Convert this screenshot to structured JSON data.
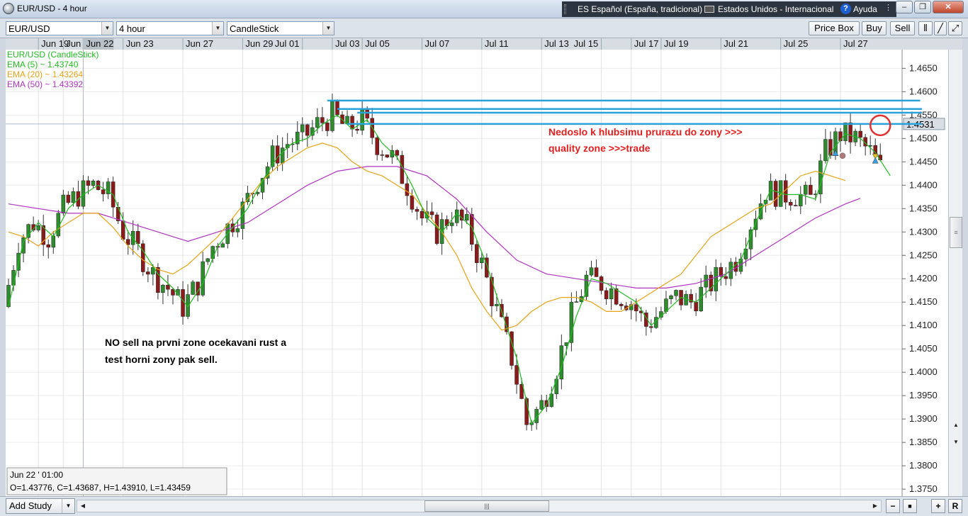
{
  "window": {
    "title": "EUR/USD - 4 hour",
    "lang_bar": {
      "language": "ES Español (España, tradicional)",
      "keyboard": "Estados Unidos - Internacional",
      "help": "Ayuda"
    },
    "buttons": {
      "minimize": "–",
      "restore": "❐",
      "close": "✕"
    }
  },
  "toolbar": {
    "symbol": "EUR/USD",
    "interval": "4 hour",
    "chart_style": "CandleStick",
    "price_box": "Price Box",
    "buy": "Buy",
    "sell": "Sell"
  },
  "legend": [
    {
      "text": "EUR/USD (CandleStick)",
      "color": "#22bb22"
    },
    {
      "text": "EMA (5) ~ 1.43740",
      "color": "#22bb22"
    },
    {
      "text": "EMA (20) ~ 1.43264",
      "color": "#e8a317"
    },
    {
      "text": "EMA (50) ~ 1.43392",
      "color": "#b033c0"
    }
  ],
  "annotations": {
    "top_right": [
      "Nedoslo k hlubsimu prurazu do zony >>>",
      "quality zone >>>trade"
    ],
    "bottom_left": [
      "NO sell na prvni zone ocekavani rust a",
      "test horni zony pak sell."
    ]
  },
  "info_box": {
    "date": "Jun 22 ' 01:00",
    "ohlc": "O=1.43776, C=1.43687, H=1.43910, L=1.43459"
  },
  "bottom": {
    "add_study": "Add Study",
    "scroll_grip": "|||",
    "r_button": "R"
  },
  "colors": {
    "bull": "#2e8b2e",
    "bear": "#8b1a1a",
    "ema5": "#22bb22",
    "ema20": "#e8a317",
    "ema50": "#b033c0",
    "zone": "#2aa1d8",
    "annot": "#e02020",
    "circle": "#e03030"
  },
  "chart_data": {
    "type": "candlestick",
    "symbol": "EUR/USD",
    "interval": "4 hour",
    "ylim": [
      1.3735,
      1.469
    ],
    "y_ticks": [
      1.375,
      1.38,
      1.385,
      1.39,
      1.395,
      1.4,
      1.405,
      1.41,
      1.415,
      1.42,
      1.425,
      1.43,
      1.435,
      1.44,
      1.445,
      1.45,
      1.455,
      1.46,
      1.465
    ],
    "y_tick_labels": [
      "1.3750",
      "1.3800",
      "1.3850",
      "1.3900",
      "1.3950",
      "1.4000",
      "1.4050",
      "1.4100",
      "1.4150",
      "1.4200",
      "1.4250",
      "1.4300",
      "1.4350",
      "1.4400",
      "1.4450",
      "1.4500",
      "1.4550",
      "1.4600",
      "1.4650"
    ],
    "current_price": "1.4531",
    "x_labels": [
      {
        "label": "Jun 19",
        "bar": 6
      },
      {
        "label": "Jun 21",
        "bar": 11
      },
      {
        "label": "Jun 22",
        "bar": 15
      },
      {
        "label": "Jun 23",
        "bar": 23
      },
      {
        "label": "Jun 27",
        "bar": 35
      },
      {
        "label": "Jun 29",
        "bar": 47
      },
      {
        "label": "Jul 01",
        "bar": 59
      },
      {
        "label": "Jul 03",
        "bar": 65
      },
      {
        "label": "Jul 05",
        "bar": 71
      },
      {
        "label": "Jul 07",
        "bar": 83
      },
      {
        "label": "Jul 11",
        "bar": 95
      },
      {
        "label": "Jul 13",
        "bar": 107
      },
      {
        "label": "Jul 15",
        "bar": 119
      },
      {
        "label": "Jul 17",
        "bar": 125
      },
      {
        "label": "Jul 19",
        "bar": 131
      },
      {
        "label": "Jul 21",
        "bar": 143
      },
      {
        "label": "Jul 25",
        "bar": 155
      },
      {
        "label": "Jul 27",
        "bar": 167
      }
    ],
    "zones": [
      {
        "y": 1.4581,
        "from_bar": 64,
        "to_bar": 183
      },
      {
        "y": 1.4563,
        "from_bar": 66,
        "to_bar": 186
      },
      {
        "y": 1.4555,
        "from_bar": 70,
        "to_bar": 186
      },
      {
        "y": 1.4531,
        "from_bar": 68,
        "to_bar": 186
      }
    ],
    "circle": {
      "bar": 175,
      "y": 1.4528
    },
    "ema5": [
      [
        0,
        1.414
      ],
      [
        3,
        1.428
      ],
      [
        6,
        1.432
      ],
      [
        9,
        1.429
      ],
      [
        12,
        1.435
      ],
      [
        15,
        1.438
      ],
      [
        18,
        1.44
      ],
      [
        21,
        1.438
      ],
      [
        24,
        1.43
      ],
      [
        27,
        1.426
      ],
      [
        30,
        1.421
      ],
      [
        33,
        1.418
      ],
      [
        36,
        1.414
      ],
      [
        39,
        1.419
      ],
      [
        42,
        1.427
      ],
      [
        45,
        1.431
      ],
      [
        48,
        1.435
      ],
      [
        51,
        1.441
      ],
      [
        54,
        1.446
      ],
      [
        57,
        1.449
      ],
      [
        60,
        1.45
      ],
      [
        63,
        1.453
      ],
      [
        66,
        1.455
      ],
      [
        69,
        1.452
      ],
      [
        72,
        1.454
      ],
      [
        75,
        1.449
      ],
      [
        78,
        1.446
      ],
      [
        81,
        1.44
      ],
      [
        84,
        1.433
      ],
      [
        87,
        1.43
      ],
      [
        90,
        1.434
      ],
      [
        93,
        1.431
      ],
      [
        96,
        1.423
      ],
      [
        99,
        1.413
      ],
      [
        102,
        1.403
      ],
      [
        105,
        1.389
      ],
      [
        108,
        1.393
      ],
      [
        111,
        1.401
      ],
      [
        114,
        1.412
      ],
      [
        117,
        1.42
      ],
      [
        120,
        1.419
      ],
      [
        123,
        1.417
      ],
      [
        126,
        1.415
      ],
      [
        129,
        1.41
      ],
      [
        132,
        1.413
      ],
      [
        135,
        1.416
      ],
      [
        138,
        1.415
      ],
      [
        141,
        1.418
      ],
      [
        144,
        1.421
      ],
      [
        147,
        1.424
      ],
      [
        150,
        1.432
      ],
      [
        153,
        1.439
      ],
      [
        156,
        1.438
      ],
      [
        159,
        1.438
      ],
      [
        162,
        1.437
      ],
      [
        165,
        1.447
      ],
      [
        168,
        1.451
      ],
      [
        171,
        1.45
      ],
      [
        174,
        1.447
      ],
      [
        177,
        1.442
      ]
    ],
    "ema20": [
      [
        0,
        1.43
      ],
      [
        3,
        1.429
      ],
      [
        6,
        1.427
      ],
      [
        9,
        1.43
      ],
      [
        12,
        1.432
      ],
      [
        15,
        1.434
      ],
      [
        18,
        1.434
      ],
      [
        21,
        1.431
      ],
      [
        24,
        1.427
      ],
      [
        27,
        1.424
      ],
      [
        30,
        1.422
      ],
      [
        33,
        1.421
      ],
      [
        36,
        1.423
      ],
      [
        39,
        1.426
      ],
      [
        42,
        1.429
      ],
      [
        45,
        1.433
      ],
      [
        48,
        1.437
      ],
      [
        51,
        1.441
      ],
      [
        54,
        1.444
      ],
      [
        57,
        1.446
      ],
      [
        60,
        1.448
      ],
      [
        63,
        1.449
      ],
      [
        66,
        1.448
      ],
      [
        69,
        1.445
      ],
      [
        72,
        1.443
      ],
      [
        75,
        1.442
      ],
      [
        78,
        1.44
      ],
      [
        81,
        1.438
      ],
      [
        84,
        1.434
      ],
      [
        87,
        1.43
      ],
      [
        90,
        1.425
      ],
      [
        93,
        1.418
      ],
      [
        96,
        1.413
      ],
      [
        99,
        1.409
      ],
      [
        102,
        1.41
      ],
      [
        105,
        1.413
      ],
      [
        108,
        1.415
      ],
      [
        111,
        1.416
      ],
      [
        114,
        1.416
      ],
      [
        117,
        1.415
      ],
      [
        120,
        1.413
      ],
      [
        123,
        1.413
      ],
      [
        126,
        1.415
      ],
      [
        129,
        1.417
      ],
      [
        132,
        1.419
      ],
      [
        135,
        1.421
      ],
      [
        138,
        1.425
      ],
      [
        141,
        1.429
      ],
      [
        144,
        1.431
      ],
      [
        147,
        1.433
      ],
      [
        150,
        1.435
      ],
      [
        153,
        1.436
      ],
      [
        156,
        1.439
      ],
      [
        159,
        1.442
      ],
      [
        162,
        1.443
      ],
      [
        165,
        1.442
      ],
      [
        168,
        1.441
      ]
    ],
    "ema50": [
      [
        0,
        1.436
      ],
      [
        6,
        1.435
      ],
      [
        12,
        1.434
      ],
      [
        18,
        1.434
      ],
      [
        24,
        1.432
      ],
      [
        30,
        1.43
      ],
      [
        36,
        1.428
      ],
      [
        42,
        1.43
      ],
      [
        48,
        1.432
      ],
      [
        54,
        1.436
      ],
      [
        60,
        1.44
      ],
      [
        66,
        1.443
      ],
      [
        72,
        1.444
      ],
      [
        78,
        1.444
      ],
      [
        84,
        1.442
      ],
      [
        90,
        1.437
      ],
      [
        96,
        1.43
      ],
      [
        102,
        1.424
      ],
      [
        108,
        1.421
      ],
      [
        114,
        1.42
      ],
      [
        120,
        1.419
      ],
      [
        126,
        1.418
      ],
      [
        132,
        1.418
      ],
      [
        138,
        1.419
      ],
      [
        144,
        1.421
      ],
      [
        150,
        1.425
      ],
      [
        156,
        1.429
      ],
      [
        162,
        1.433
      ],
      [
        168,
        1.436
      ],
      [
        171,
        1.4372
      ]
    ],
    "ohlc_generator": "procedural"
  }
}
